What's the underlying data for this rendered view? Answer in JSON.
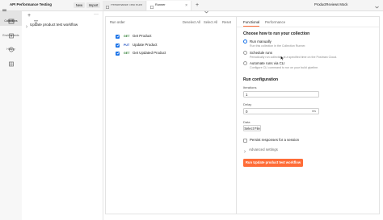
{
  "app": {
    "workspace_title": "API Performance Testing",
    "new_label": "New",
    "import_label": "Import",
    "environment": "ProductReviews Mock",
    "colors": {
      "accent": "#ff6c37",
      "primary": "#1a73e8",
      "get": "#2e7d32",
      "put": "#1f4fbf"
    }
  },
  "tabs": [
    {
      "label": "Performance Test Runner",
      "icon": "runner-icon"
    },
    {
      "label": "Runner",
      "icon": "runner-icon"
    }
  ],
  "nav": [
    {
      "label": "Collections",
      "icon": "collections-icon"
    },
    {
      "label": "Environments",
      "icon": "environments-icon"
    },
    {
      "label": "History",
      "icon": "history-icon"
    },
    {
      "label": "",
      "icon": "configure-icon"
    }
  ],
  "sidebar": {
    "items": [
      {
        "label": "Update product test workflow"
      }
    ]
  },
  "run_order": {
    "title": "Run order",
    "deselect_all": "Deselect All",
    "select_all": "Select All",
    "reset": "Reset",
    "requests": [
      {
        "method": "GET",
        "name": "Get Product",
        "checked": true
      },
      {
        "method": "PUT",
        "name": "Update Product",
        "checked": true
      },
      {
        "method": "GET",
        "name": "Get Updated Product",
        "checked": true
      }
    ]
  },
  "config": {
    "tabs": [
      "Functional",
      "Performance"
    ],
    "active_tab": "Functional",
    "how_title": "Choose how to run your collection",
    "options": [
      {
        "label": "Run manually",
        "desc": "Run this collection in the Collection Runner.",
        "selected": true
      },
      {
        "label": "Schedule runs",
        "desc": "Periodically run collection at a specified time on the Postman Cloud.",
        "selected": false
      },
      {
        "label": "Automate runs via CLI",
        "desc": "Configure CLI command to run on your build pipeline.",
        "selected": false
      }
    ],
    "run_config_title": "Run configuration",
    "iterations_label": "Iterations",
    "iterations_value": "1",
    "delay_label": "Delay",
    "delay_value": "0",
    "delay_unit": "ms",
    "data_label": "Data",
    "select_file_label": "Select File",
    "persist_label": "Persist responses for a session",
    "advanced_label": "Advanced settings",
    "run_button": "Run Update product test workflow"
  }
}
